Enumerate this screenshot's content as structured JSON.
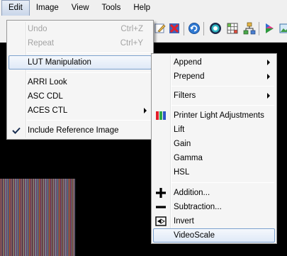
{
  "menubar": [
    "Edit",
    "Image",
    "View",
    "Tools",
    "Help"
  ],
  "edit_menu": {
    "undo": {
      "label": "Undo",
      "shortcut": "Ctrl+Z"
    },
    "redo": {
      "label": "Repeat",
      "shortcut": "Ctrl+Y"
    },
    "lut_manipulation": "LUT Manipulation",
    "arri_look": "ARRI Look",
    "asc_cdl": "ASC CDL",
    "aces_ctl": "ACES CTL",
    "include_reference": "Include Reference Image"
  },
  "lut_submenu": {
    "append": "Append",
    "prepend": "Prepend",
    "filters": "Filters",
    "printer_light": "Printer Light Adjustments",
    "lift": "Lift",
    "gain": "Gain",
    "gamma": "Gamma",
    "hsl": "HSL",
    "addition": "Addition...",
    "subtraction": "Subtraction...",
    "invert": "Invert",
    "videoscale": "VideoScale"
  },
  "colors": {
    "highlight_border": "#7da2ce",
    "menu_bg": "#f5f5f5",
    "canvas_bg": "#000000"
  },
  "icons": [
    "edit-icon",
    "close-red-icon",
    "refresh-icon",
    "color-target-icon",
    "grid-icon",
    "network-icon",
    "play-icon",
    "picture-icon"
  ]
}
